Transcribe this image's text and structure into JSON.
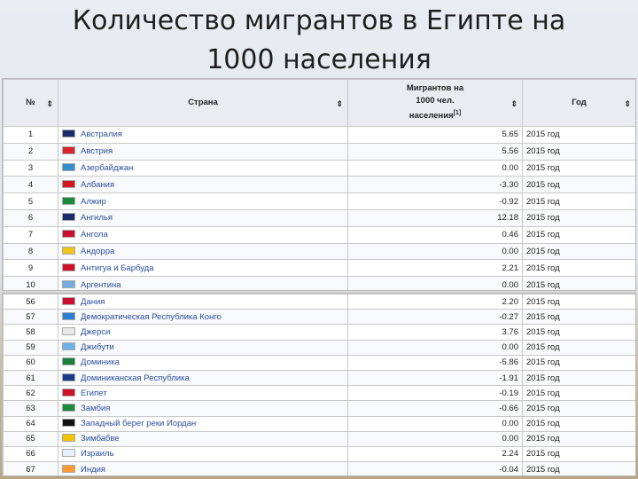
{
  "title_line1": "Количество мигрантов в Египте на",
  "title_line2": "1000 населения",
  "table": {
    "headers": {
      "num": "№",
      "country": "Страна",
      "migrants_1": "Мигрантов на",
      "migrants_2": "1000 чел.",
      "migrants_3": "населения",
      "migrants_ref": "[1]",
      "year": "Год",
      "sort_glyph": "⇕"
    },
    "rows_top": [
      {
        "n": "1",
        "country": "Австралия",
        "value": "5.65",
        "year": "2015 год",
        "flag": "#1b2a6b"
      },
      {
        "n": "2",
        "country": "Австрия",
        "value": "5.56",
        "year": "2015 год",
        "flag": "#d9232e"
      },
      {
        "n": "3",
        "country": "Азербайджан",
        "value": "0.00",
        "year": "2015 год",
        "flag": "#2f8fcf"
      },
      {
        "n": "4",
        "country": "Албания",
        "value": "-3.30",
        "year": "2015 год",
        "flag": "#d3151d"
      },
      {
        "n": "5",
        "country": "Алжир",
        "value": "-0.92",
        "year": "2015 год",
        "flag": "#1b8a3a"
      },
      {
        "n": "6",
        "country": "Ангилья",
        "value": "12.18",
        "year": "2015 год",
        "flag": "#1b2a6b"
      },
      {
        "n": "7",
        "country": "Ангола",
        "value": "0.46",
        "year": "2015 год",
        "flag": "#c8102e"
      },
      {
        "n": "8",
        "country": "Андорра",
        "value": "0.00",
        "year": "2015 год",
        "flag": "#f0c419"
      },
      {
        "n": "9",
        "country": "Антигуа и Барбуда",
        "value": "2.21",
        "year": "2015 год",
        "flag": "#ce1126"
      },
      {
        "n": "10",
        "country": "Аргентина",
        "value": "0.00",
        "year": "2015 год",
        "flag": "#74acdf"
      }
    ],
    "rows_bottom": [
      {
        "n": "56",
        "country": "Дания",
        "value": "2.20",
        "year": "2015 год",
        "flag": "#c8102e"
      },
      {
        "n": "57",
        "country": "Демократическая Республика Конго",
        "value": "-0.27",
        "year": "2015 год",
        "flag": "#2a7fd4"
      },
      {
        "n": "58",
        "country": "Джерси",
        "value": "3.76",
        "year": "2015 год",
        "flag": "#e8e8e8"
      },
      {
        "n": "59",
        "country": "Джибути",
        "value": "0.00",
        "year": "2015 год",
        "flag": "#6ab2e7"
      },
      {
        "n": "60",
        "country": "Доминика",
        "value": "-5.86",
        "year": "2015 год",
        "flag": "#1a7f3a"
      },
      {
        "n": "61",
        "country": "Доминиканская Республика",
        "value": "-1.91",
        "year": "2015 год",
        "flag": "#1b3a8a"
      },
      {
        "n": "62",
        "country": "Египет",
        "value": "-0.19",
        "year": "2015 год",
        "flag": "#ce1126"
      },
      {
        "n": "63",
        "country": "Замбия",
        "value": "-0.66",
        "year": "2015 год",
        "flag": "#1b8a3a"
      },
      {
        "n": "64",
        "country": "Западный берег реки Иордан",
        "value": "0.00",
        "year": "2015 год",
        "flag": "#111111"
      },
      {
        "n": "65",
        "country": "Зимбабве",
        "value": "0.00",
        "year": "2015 год",
        "flag": "#f3c300"
      },
      {
        "n": "66",
        "country": "Израиль",
        "value": "2.24",
        "year": "2015 год",
        "flag": "#e8eefc"
      },
      {
        "n": "67",
        "country": "Индия",
        "value": "-0.04",
        "year": "2015 год",
        "flag": "#ff9933"
      }
    ]
  }
}
